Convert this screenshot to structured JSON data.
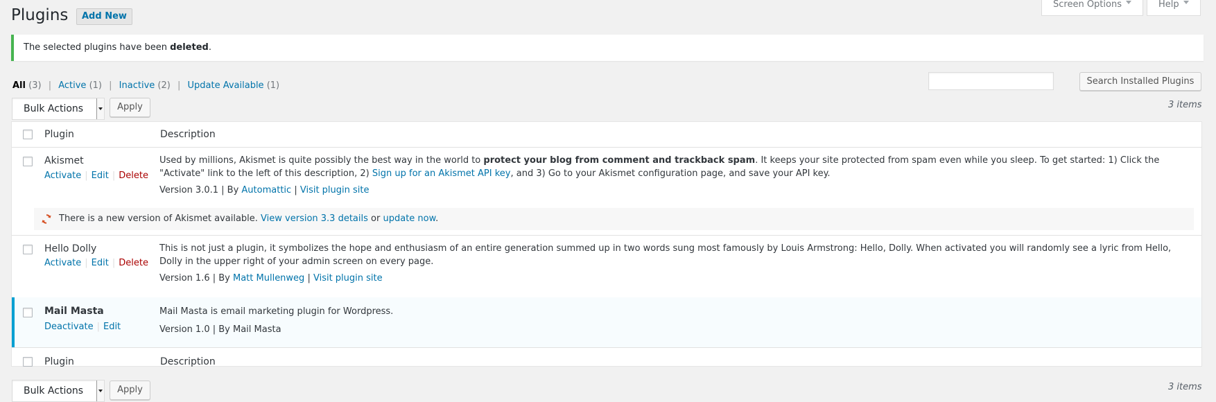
{
  "header": {
    "title": "Plugins",
    "add_new": "Add New",
    "screen_options": "Screen Options",
    "help": "Help"
  },
  "notice": {
    "prefix": "The selected plugins have been ",
    "bold": "deleted",
    "suffix": "."
  },
  "filters": {
    "all": {
      "label": "All",
      "count": "(3)"
    },
    "active": {
      "label": "Active",
      "count": "(1)"
    },
    "inactive": {
      "label": "Inactive",
      "count": "(2)"
    },
    "update": {
      "label": "Update Available",
      "count": "(1)"
    },
    "separator": "|"
  },
  "search": {
    "placeholder": "",
    "button": "Search Installed Plugins"
  },
  "bulk": {
    "select": "Bulk Actions",
    "apply": "Apply"
  },
  "items_count": "3 items",
  "table": {
    "col_plugin": "Plugin",
    "col_description": "Description"
  },
  "plugins": {
    "akismet": {
      "name": "Akismet",
      "activate": "Activate",
      "edit": "Edit",
      "delete": "Delete",
      "desc_1": "Used by millions, Akismet is quite possibly the best way in the world to ",
      "desc_bold": "protect your blog from comment and trackback spam",
      "desc_2": ". It keeps your site protected from spam even while you sleep. To get started: 1) Click the",
      "desc_3": "\"Activate\" link to the left of this description, 2) ",
      "desc_link": "Sign up for an Akismet API key",
      "desc_4": ", and 3) Go to your Akismet configuration page, and save your API key.",
      "version": "Version 3.0.1 | By ",
      "author": "Automattic",
      "pipe": " | ",
      "visit": "Visit plugin site",
      "update_text": "There is a new version of Akismet available. ",
      "update_link": "View version 3.3 details",
      "update_or": " or ",
      "update_now": "update now",
      "update_end": "."
    },
    "hello_dolly": {
      "name": "Hello Dolly",
      "activate": "Activate",
      "edit": "Edit",
      "delete": "Delete",
      "desc_1": "This is not just a plugin, it symbolizes the hope and enthusiasm of an entire generation summed up in two words sung most famously by Louis Armstrong: Hello, Dolly. When activated you will randomly see a lyric from Hello,",
      "desc_2": "Dolly in the upper right of your admin screen on every page.",
      "version": "Version 1.6 | By ",
      "author": "Matt Mullenweg",
      "pipe": " | ",
      "visit": "Visit plugin site"
    },
    "mail_masta": {
      "name": "Mail Masta",
      "deactivate": "Deactivate",
      "edit": "Edit",
      "desc": "Mail Masta is email marketing plugin for Wordpress.",
      "version": "Version 1.0 | By Mail Masta"
    }
  },
  "colors": {
    "link": "#0073aa",
    "notice_border": "#46b450",
    "active_border": "#00a0d2",
    "delete": "#a00",
    "update_icon": "#d54e21"
  }
}
